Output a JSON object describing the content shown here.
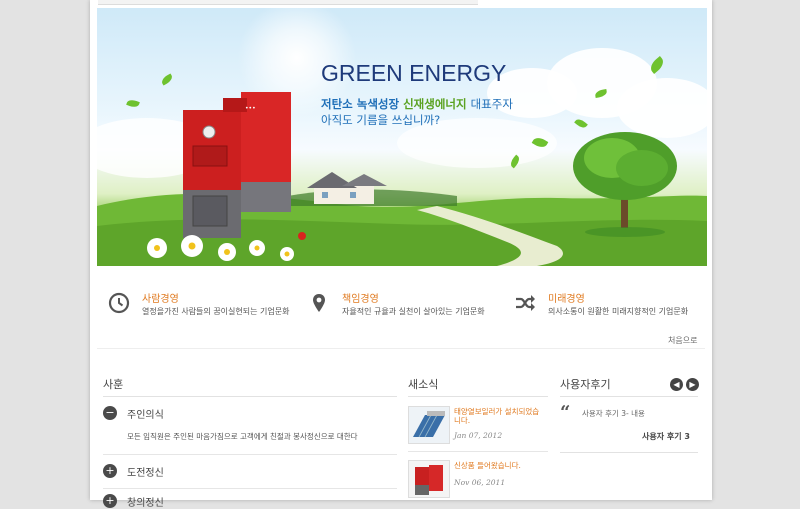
{
  "hero": {
    "title": "GREEN ENERGY",
    "line1_a": "저탄소 녹색성장",
    "line1_b": "신재생에너지",
    "line1_c": "대표주자",
    "line2": "아직도 기름을 쓰십니까?"
  },
  "features": [
    {
      "icon": "clock-icon",
      "title": "사람경영",
      "desc": "열정을가진 사람들의 꿈이실현되는 기업문화"
    },
    {
      "icon": "location-pin-icon",
      "title": "책임경영",
      "desc": "자율적인 규율과 실천이 살아있는 기업문화"
    },
    {
      "icon": "shuffle-icon",
      "title": "미래경영",
      "desc": "의사소통이 원활한 미래지향적인 기업문화"
    }
  ],
  "more_link": "처음으로",
  "company_motto": {
    "heading": "사훈",
    "items": [
      {
        "label": "주인의식",
        "expanded": true,
        "body": "모든 임직원은 주인된 마음가짐으로 고객에게 친절과 봉사정신으로 대한다"
      },
      {
        "label": "도전정신",
        "expanded": false
      },
      {
        "label": "창의정신",
        "expanded": false
      }
    ]
  },
  "news": {
    "heading": "새소식",
    "items": [
      {
        "title": "태양열보일러가 설치되었습니다.",
        "date": "Jan 07, 2012"
      },
      {
        "title": "신상품 들어왔습니다.",
        "date": "Nov 06, 2011"
      }
    ]
  },
  "reviews": {
    "heading": "사용자후기",
    "prev_icon": "chevron-left-icon",
    "next_icon": "chevron-right-icon",
    "quote_icon": "quote-icon",
    "text": "사용자 후기 3- 내용",
    "author": "사용자 후기 3"
  },
  "colors": {
    "accent": "#e07a20",
    "brand_blue": "#1f6fb8",
    "brand_green": "#5aa221"
  }
}
